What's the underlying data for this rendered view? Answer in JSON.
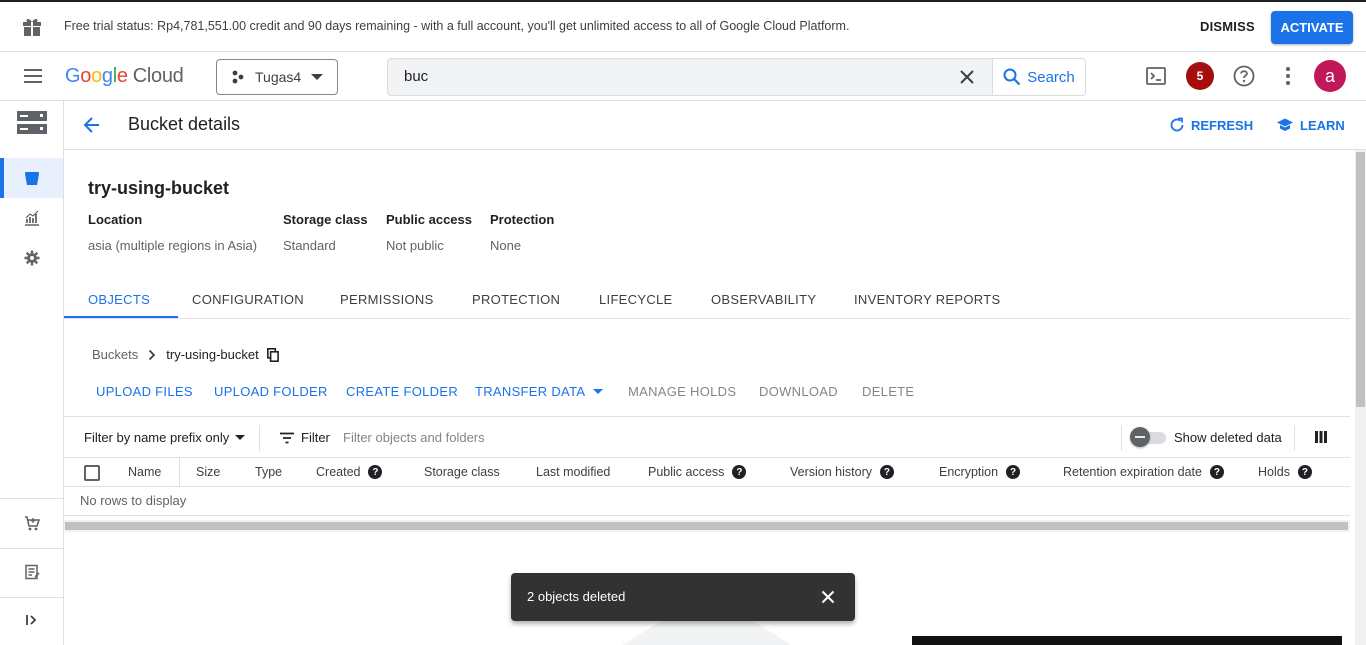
{
  "banner": {
    "text": "Free trial status: Rp4,781,551.00 credit and 90 days remaining - with a full account, you'll get unlimited access to all of Google Cloud Platform.",
    "dismiss": "DISMISS",
    "activate": "ACTIVATE"
  },
  "header": {
    "logo_letters": [
      "G",
      "o",
      "o",
      "g",
      "l",
      "e"
    ],
    "logo_product": "Cloud",
    "project": "Tugas4",
    "search_value": "buc",
    "search_button": "Search",
    "notifications_count": "5",
    "avatar_letter": "a"
  },
  "page": {
    "title": "Bucket details",
    "refresh": "REFRESH",
    "learn": "LEARN"
  },
  "bucket": {
    "name": "try-using-bucket",
    "meta": [
      {
        "key": "Location",
        "value": "asia (multiple regions in Asia)"
      },
      {
        "key": "Storage class",
        "value": "Standard"
      },
      {
        "key": "Public access",
        "value": "Not public"
      },
      {
        "key": "Protection",
        "value": "None"
      }
    ]
  },
  "tabs": [
    "OBJECTS",
    "CONFIGURATION",
    "PERMISSIONS",
    "PROTECTION",
    "LIFECYCLE",
    "OBSERVABILITY",
    "INVENTORY REPORTS"
  ],
  "breadcrumb": {
    "root": "Buckets",
    "current": "try-using-bucket"
  },
  "actions": {
    "upload_files": "UPLOAD FILES",
    "upload_folder": "UPLOAD FOLDER",
    "create_folder": "CREATE FOLDER",
    "transfer_data": "TRANSFER DATA",
    "manage_holds": "MANAGE HOLDS",
    "download": "DOWNLOAD",
    "delete": "DELETE"
  },
  "filter": {
    "prefix_select": "Filter by name prefix only",
    "label": "Filter",
    "placeholder": "Filter objects and folders",
    "show_deleted": "Show deleted data"
  },
  "table": {
    "columns": [
      "Name",
      "Size",
      "Type",
      "Created",
      "Storage class",
      "Last modified",
      "Public access",
      "Version history",
      "Encryption",
      "Retention expiration date",
      "Holds"
    ],
    "empty": "No rows to display"
  },
  "snackbar": {
    "message": "2 objects deleted"
  },
  "colors": {
    "accent": "#1a73e8",
    "notification": "#a50e0e",
    "avatar": "#c2185b"
  }
}
